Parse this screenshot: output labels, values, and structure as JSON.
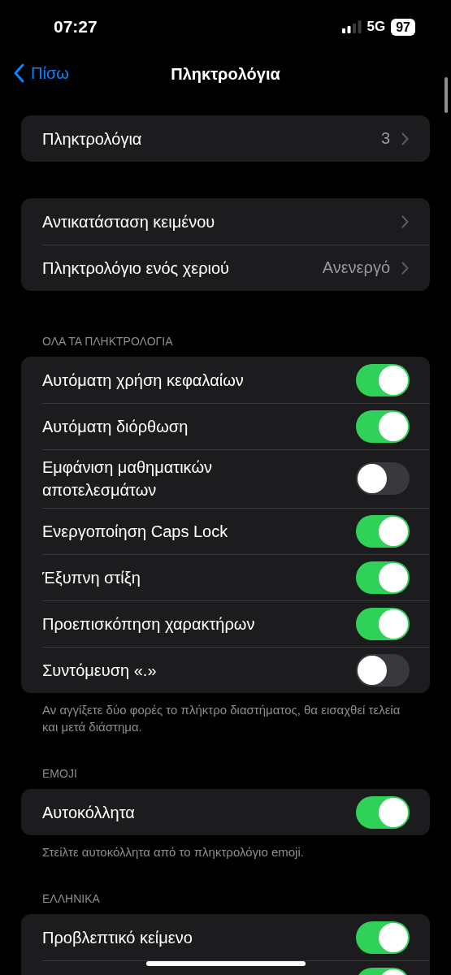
{
  "status_bar": {
    "time": "07:27",
    "network": "5G",
    "battery": "97"
  },
  "nav": {
    "back": "Πίσω",
    "title": "Πληκτρολόγια"
  },
  "sections": [
    {
      "rows": [
        {
          "kind": "nav",
          "label": "Πληκτρολόγια",
          "value": "3"
        }
      ]
    },
    {
      "rows": [
        {
          "kind": "nav",
          "label": "Αντικατάσταση κειμένου"
        },
        {
          "kind": "nav",
          "label": "Πληκτρολόγιο ενός χεριού",
          "value": "Ανενεργό"
        }
      ]
    },
    {
      "header": "ΟΛΑ ΤΑ ΠΛΗΚΤΡΟΛΟΓΙΑ",
      "rows": [
        {
          "kind": "toggle",
          "label": "Αυτόματη χρήση κεφαλαίων",
          "on": true
        },
        {
          "kind": "toggle",
          "label": "Αυτόματη διόρθωση",
          "on": true
        },
        {
          "kind": "toggle",
          "label": "Εμφάνιση μαθηματικών αποτελεσμάτων",
          "on": false
        },
        {
          "kind": "toggle",
          "label": "Ενεργοποίηση Caps Lock",
          "on": true
        },
        {
          "kind": "toggle",
          "label": "Έξυπνη στίξη",
          "on": true
        },
        {
          "kind": "toggle",
          "label": "Προεπισκόπηση χαρακτήρων",
          "on": true
        },
        {
          "kind": "toggle",
          "label": "Συντόμευση «.»",
          "on": false
        }
      ],
      "footer": "Αν αγγίξετε δύο φορές το πλήκτρο διαστήματος, θα εισαχθεί τελεία και μετά διάστημα."
    },
    {
      "header": "EMOJI",
      "rows": [
        {
          "kind": "toggle",
          "label": "Αυτοκόλλητα",
          "on": true
        }
      ],
      "footer": "Στείλτε αυτοκόλλητα από το πληκτρολόγιο emoji."
    },
    {
      "header": "ΕΛΛΗΝΙΚΑ",
      "rows": [
        {
          "kind": "toggle",
          "label": "Προβλεπτικό κείμενο",
          "on": true
        },
        {
          "kind": "toggle",
          "on": true
        }
      ]
    }
  ]
}
